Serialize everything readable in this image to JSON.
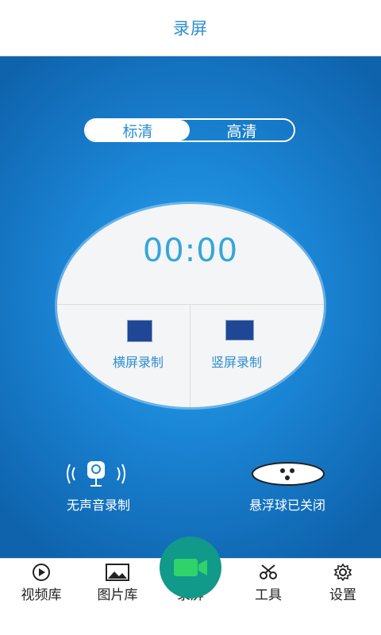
{
  "header": {
    "title": "录屏"
  },
  "quality": {
    "options": [
      "标清",
      "高清"
    ],
    "selected": "标清"
  },
  "recorder": {
    "timer": "00:00",
    "landscape_label": "横屏录制",
    "portrait_label": "竖屏录制"
  },
  "controls": {
    "mute_label": "无声音录制",
    "floating_ball_label": "悬浮球已关闭"
  },
  "nav": {
    "items": [
      {
        "label": "视频库",
        "icon": "play-circle-icon"
      },
      {
        "label": "图片库",
        "icon": "image-icon"
      },
      {
        "label": "录屏",
        "icon": "video-camera-icon"
      },
      {
        "label": "工具",
        "icon": "scissors-icon"
      },
      {
        "label": "设置",
        "icon": "gear-icon"
      }
    ],
    "active": "录屏"
  },
  "colors": {
    "accent": "#2d8fd0",
    "background_blue": "#1b86d6",
    "fab": "#11998a",
    "record_icon": "#1f4796",
    "camera_icon": "#2fd36a"
  }
}
